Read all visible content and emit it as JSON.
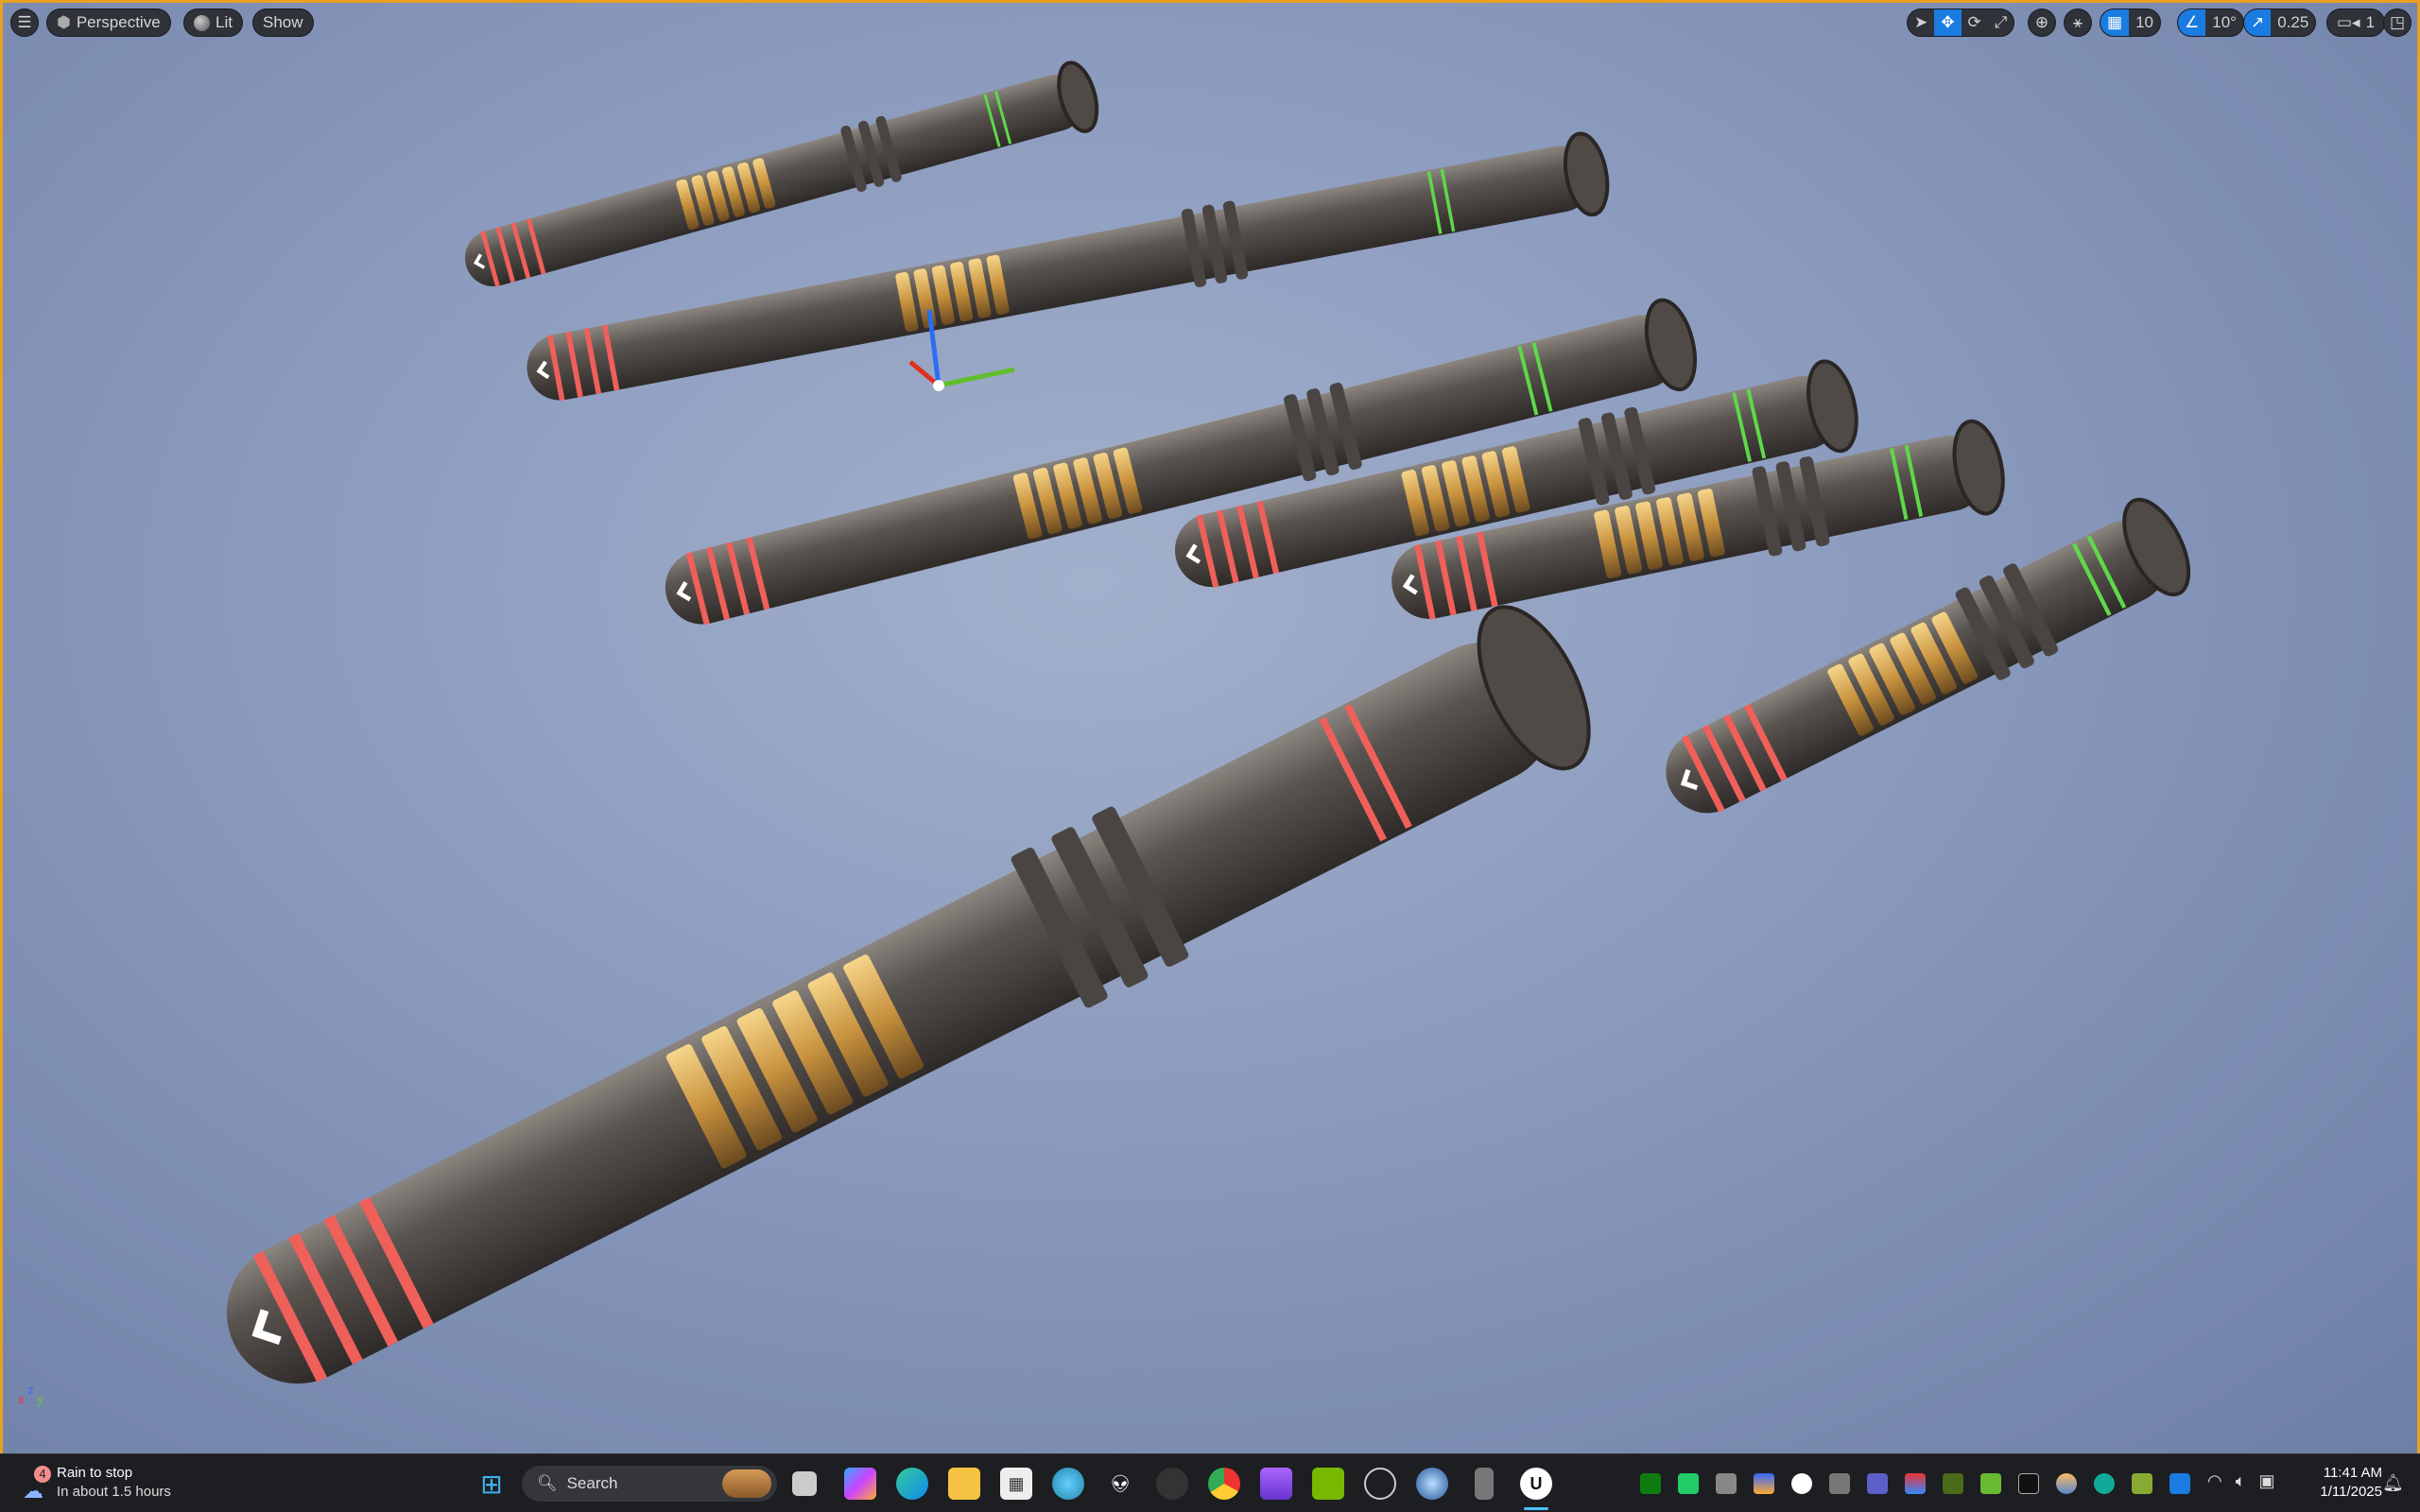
{
  "viewport": {
    "menu_icon": "hamburger-icon",
    "view_mode": "Perspective",
    "lighting_mode": "Lit",
    "show_label": "Show",
    "grid_snap": "10",
    "rotation_snap": "10°",
    "scale_snap": "0.25",
    "camera_speed": "1",
    "accent": "#1a7be0",
    "border": "#e8a020"
  },
  "axis": {
    "x": "x",
    "y": "y",
    "z": "z"
  },
  "taskbar": {
    "weather_badge": "4",
    "weather_title": "Rain to stop",
    "weather_sub": "In about 1.5 hours",
    "search_placeholder": "Search",
    "time": "11:41 AM",
    "date": "1/11/2025"
  }
}
